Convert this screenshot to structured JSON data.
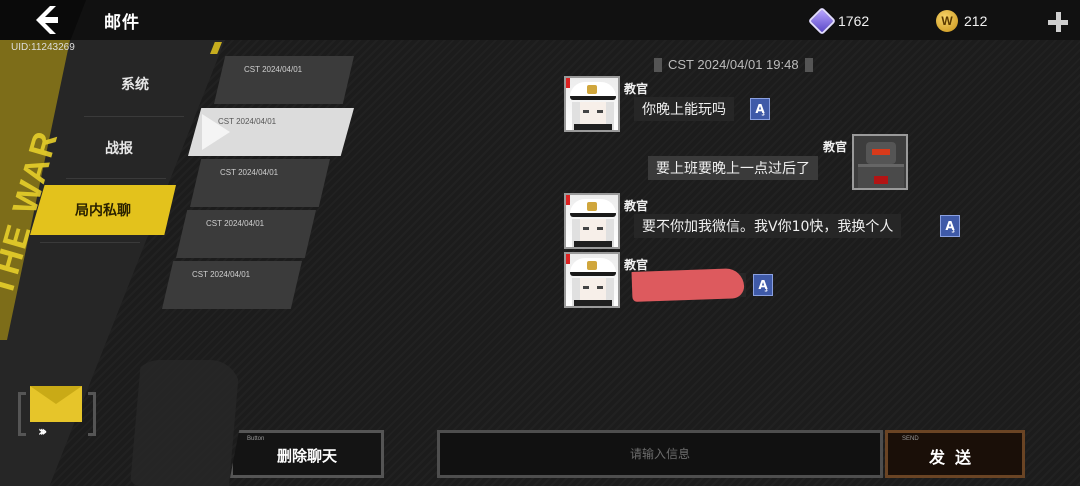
{
  "header": {
    "title": "邮件",
    "uid": "UID:11243269",
    "gem_count": "1762",
    "coin_count": "212",
    "coin_symbol": "W"
  },
  "decor": {
    "vertical_text": "THE WAR"
  },
  "categories": [
    {
      "label": "系统"
    },
    {
      "label": "战报"
    },
    {
      "label": "局内私聊"
    }
  ],
  "mail_list": [
    {
      "date": "CST 2024/04/01"
    },
    {
      "date": "CST 2024/04/01"
    },
    {
      "date": "CST 2024/04/01"
    },
    {
      "date": "CST 2024/04/01"
    },
    {
      "date": "CST 2024/04/01"
    }
  ],
  "chat": {
    "timestamp": "CST 2024/04/01 19:48",
    "translate_glyph": "A̧",
    "messages": [
      {
        "sender": "教官",
        "side": "left",
        "text": "你晚上能玩吗"
      },
      {
        "sender": "教官",
        "side": "right",
        "text": "要上班要晚上一点过后了"
      },
      {
        "sender": "教官",
        "side": "left",
        "text": "要不你加我微信。我V你10快，我换个人"
      },
      {
        "sender": "教官",
        "side": "left",
        "text": ""
      }
    ]
  },
  "footer": {
    "delete_tag": "Button",
    "delete_label": "删除聊天",
    "input_placeholder": "请输入信息",
    "send_tag": "SEND",
    "send_label": "发送"
  },
  "colors": {
    "accent_yellow": "#e3c21c",
    "translate_blue": "#3f5aa8",
    "redaction": "#dd5a5e"
  }
}
